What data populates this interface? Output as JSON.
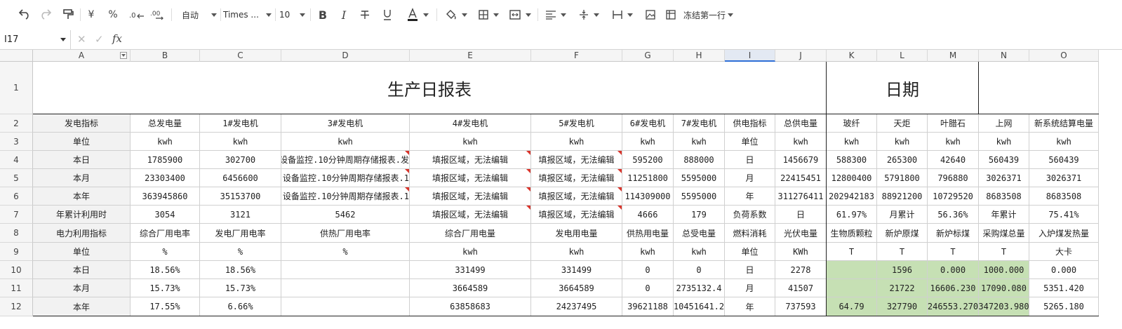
{
  "toolbar": {
    "font_size_mode": "自动",
    "font_name": "Times ...",
    "font_size": "10",
    "currency_symbol": "¥",
    "percent_symbol": "%",
    "freeze_label": "冻结第一行",
    "icons": [
      "undo-icon",
      "redo-icon",
      "format-painter-icon",
      "currency-icon",
      "percent-icon",
      "decrease-decimal-icon",
      "increase-decimal-icon",
      "bold-icon",
      "italic-icon",
      "strikethrough-icon",
      "underline-icon",
      "font-color-icon",
      "fill-color-icon",
      "border-icon",
      "merge-icon",
      "align-icon",
      "valign-icon",
      "column-width-icon",
      "image-icon",
      "freeze-icon"
    ]
  },
  "formula_bar": {
    "cell_ref": "I17",
    "fx_label": "fx",
    "value": ""
  },
  "sheet": {
    "columns": [
      "A",
      "B",
      "C",
      "D",
      "E",
      "F",
      "G",
      "H",
      "I",
      "J",
      "K",
      "L",
      "M",
      "N",
      "O"
    ],
    "selected_column": "I",
    "rows": [
      "1",
      "2",
      "3",
      "4",
      "5",
      "6",
      "7",
      "8",
      "9",
      "10",
      "11",
      "12"
    ],
    "title": "生产日报表",
    "date_title": "日期",
    "r2": [
      "发电指标",
      "总发电量",
      "1#发电机",
      "3#发电机",
      "4#发电机",
      "5#发电机",
      "6#发电机",
      "7#发电机",
      "供电指标",
      "总供电量",
      "玻纤",
      "天炬",
      "叶腊石",
      "上网",
      "新系统结算电量"
    ],
    "r3": [
      "单位",
      "kwh",
      "kwh",
      "kwh",
      "kwh",
      "kwh",
      "kwh",
      "kwh",
      "单位",
      "kwh",
      "kwh",
      "kwh",
      "kwh",
      "kwh",
      "kwh"
    ],
    "r4": [
      "本日",
      "1785900",
      "302700",
      "设备监控.10分钟周期存储报表.发",
      "填报区域，无法编辑",
      "填报区域，无法编辑",
      "595200",
      "888000",
      "日",
      "1456679",
      "588300",
      "265300",
      "42640",
      "560439",
      "560439"
    ],
    "r5": [
      "本月",
      "23303400",
      "6456600",
      ".设备监控.10分钟周期存储报表.1",
      "填报区域，无法编辑",
      "填报区域，无法编辑",
      "11251800",
      "5595000",
      "月",
      "22415451",
      "12800400",
      "5791800",
      "796880",
      "3026371",
      "3026371"
    ],
    "r6": [
      "本年",
      "363945860",
      "35153700",
      ".设备监控.10分钟周期存储报表.1",
      "填报区域，无法编辑",
      "填报区域，无法编辑",
      "114309000",
      "5595000",
      "年",
      "311276411",
      "202942183",
      "88921200",
      "10729520",
      "8683508",
      "8683508"
    ],
    "r7": [
      "年累计利用时",
      "3054",
      "3121",
      "5462",
      "填报区域，无法编辑",
      "填报区域，无法编辑",
      "4666",
      "179",
      "负荷系数",
      "日",
      "61.97%",
      "月累计",
      "56.36%",
      "年累计",
      "75.41%"
    ],
    "r8": [
      "电力利用指标",
      "综合厂用电率",
      "发电厂用电率",
      "供热厂用电率",
      "综合厂用电量",
      "发电用电量",
      "供热用电量",
      "总受电量",
      "燃料消耗",
      "光伏电量",
      "生物质颗粒",
      "新炉原煤",
      "新炉标煤",
      "采购煤总量",
      "入炉煤发热量"
    ],
    "r9": [
      "单位",
      "%",
      "%",
      "%",
      "kwh",
      "kwh",
      "kwh",
      "kwh",
      "单位",
      "KWh",
      "T",
      "T",
      "T",
      "T",
      "大卡"
    ],
    "r10": [
      "本日",
      "18.56%",
      "18.56%",
      "",
      "331499",
      "331499",
      "0",
      "0",
      "日",
      "2278",
      "",
      "1596",
      "0.000",
      "1000.000",
      "0.000"
    ],
    "r11": [
      "本月",
      "15.73%",
      "15.73%",
      "",
      "3664589",
      "3664589",
      "0",
      "2735132.4",
      "月",
      "41507",
      "",
      "21722",
      "16606.230",
      "17090.080",
      "5351.420"
    ],
    "r12": [
      "本年",
      "17.55%",
      "6.66%",
      "",
      "63858683",
      "24237495",
      "39621188",
      "10451641.2",
      "年",
      "737593",
      "64.79",
      "327790",
      "246553.270",
      "347203.980",
      "5265.180"
    ]
  },
  "colors": {
    "header_gray": "#f2f2f2",
    "highlight_green": "#c6e0b4",
    "comment_marker": "#d9342b",
    "selected_col_accent": "#2f6fd6"
  }
}
